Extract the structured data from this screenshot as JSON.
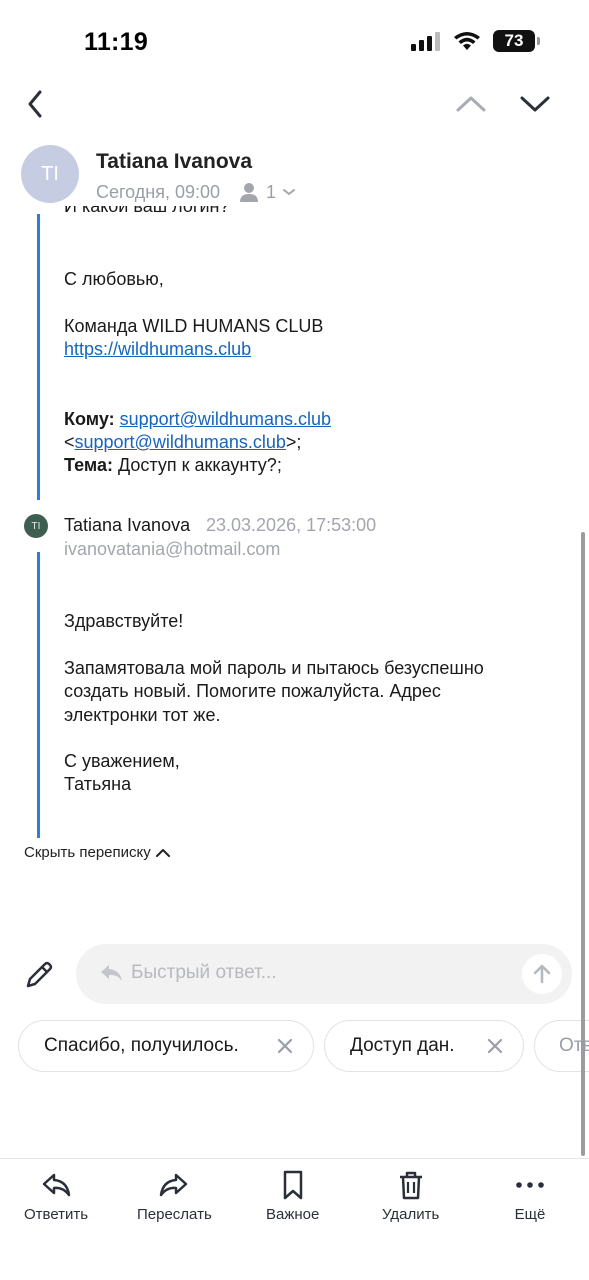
{
  "status_bar": {
    "time": "11:19",
    "battery": "73"
  },
  "sender": {
    "initials": "TI",
    "name": "Tatiana Ivanova",
    "date": "Сегодня, 09:00",
    "recipients_count": "1"
  },
  "quoted": {
    "cut_line": "И какой ваш логин?",
    "greeting": "С любовью,",
    "team": "Команда WILD HUMANS CLUB",
    "site_link": "https://wildhumans.club",
    "to_label": "Кому:",
    "to_email": "support@wildhumans.club",
    "to_email2": "support@wildhumans.club",
    "subject_label": "Тема:",
    "subject": "Доступ к аккаунту?;"
  },
  "message2": {
    "initials": "TI",
    "name": "Tatiana Ivanova",
    "date": "23.03.2026, 17:53:00",
    "email": "ivanovatania@hotmail.com",
    "hello": "Здравствуйте!",
    "body_1": "Запамятовала мой пароль и пытаюсь безуспешно",
    "body_2": "создать новый. Помогите пожалуйста. Адрес",
    "body_3": "электронки тот же.",
    "sign_1": "С уважением,",
    "sign_2": "Татьяна"
  },
  "hide_thread_label": "Скрыть переписку",
  "quick_reply": {
    "placeholder": "Быстрый ответ..."
  },
  "suggestions": [
    "Спасибо, получилось.",
    "Доступ дан.",
    "Отв"
  ],
  "toolbar": {
    "reply": "Ответить",
    "forward": "Переслать",
    "important": "Важное",
    "delete": "Удалить",
    "more": "Ещё"
  },
  "colors": {
    "accent": "#2d7ed7",
    "link": "#1565c0",
    "avatar": "#c6cde3",
    "avatar_small": "#3f5e52"
  },
  "icons": [
    "cellular-signal-icon",
    "wifi-icon",
    "battery-icon",
    "back-chevron-icon",
    "up-chevron-icon",
    "down-chevron-icon",
    "person-icon",
    "chevron-down-icon",
    "chevron-up-icon",
    "pencil-icon",
    "reply-arrow-icon",
    "send-arrow-icon",
    "close-icon",
    "reply-icon",
    "forward-icon",
    "bookmark-icon",
    "trash-icon",
    "more-dots-icon"
  ]
}
